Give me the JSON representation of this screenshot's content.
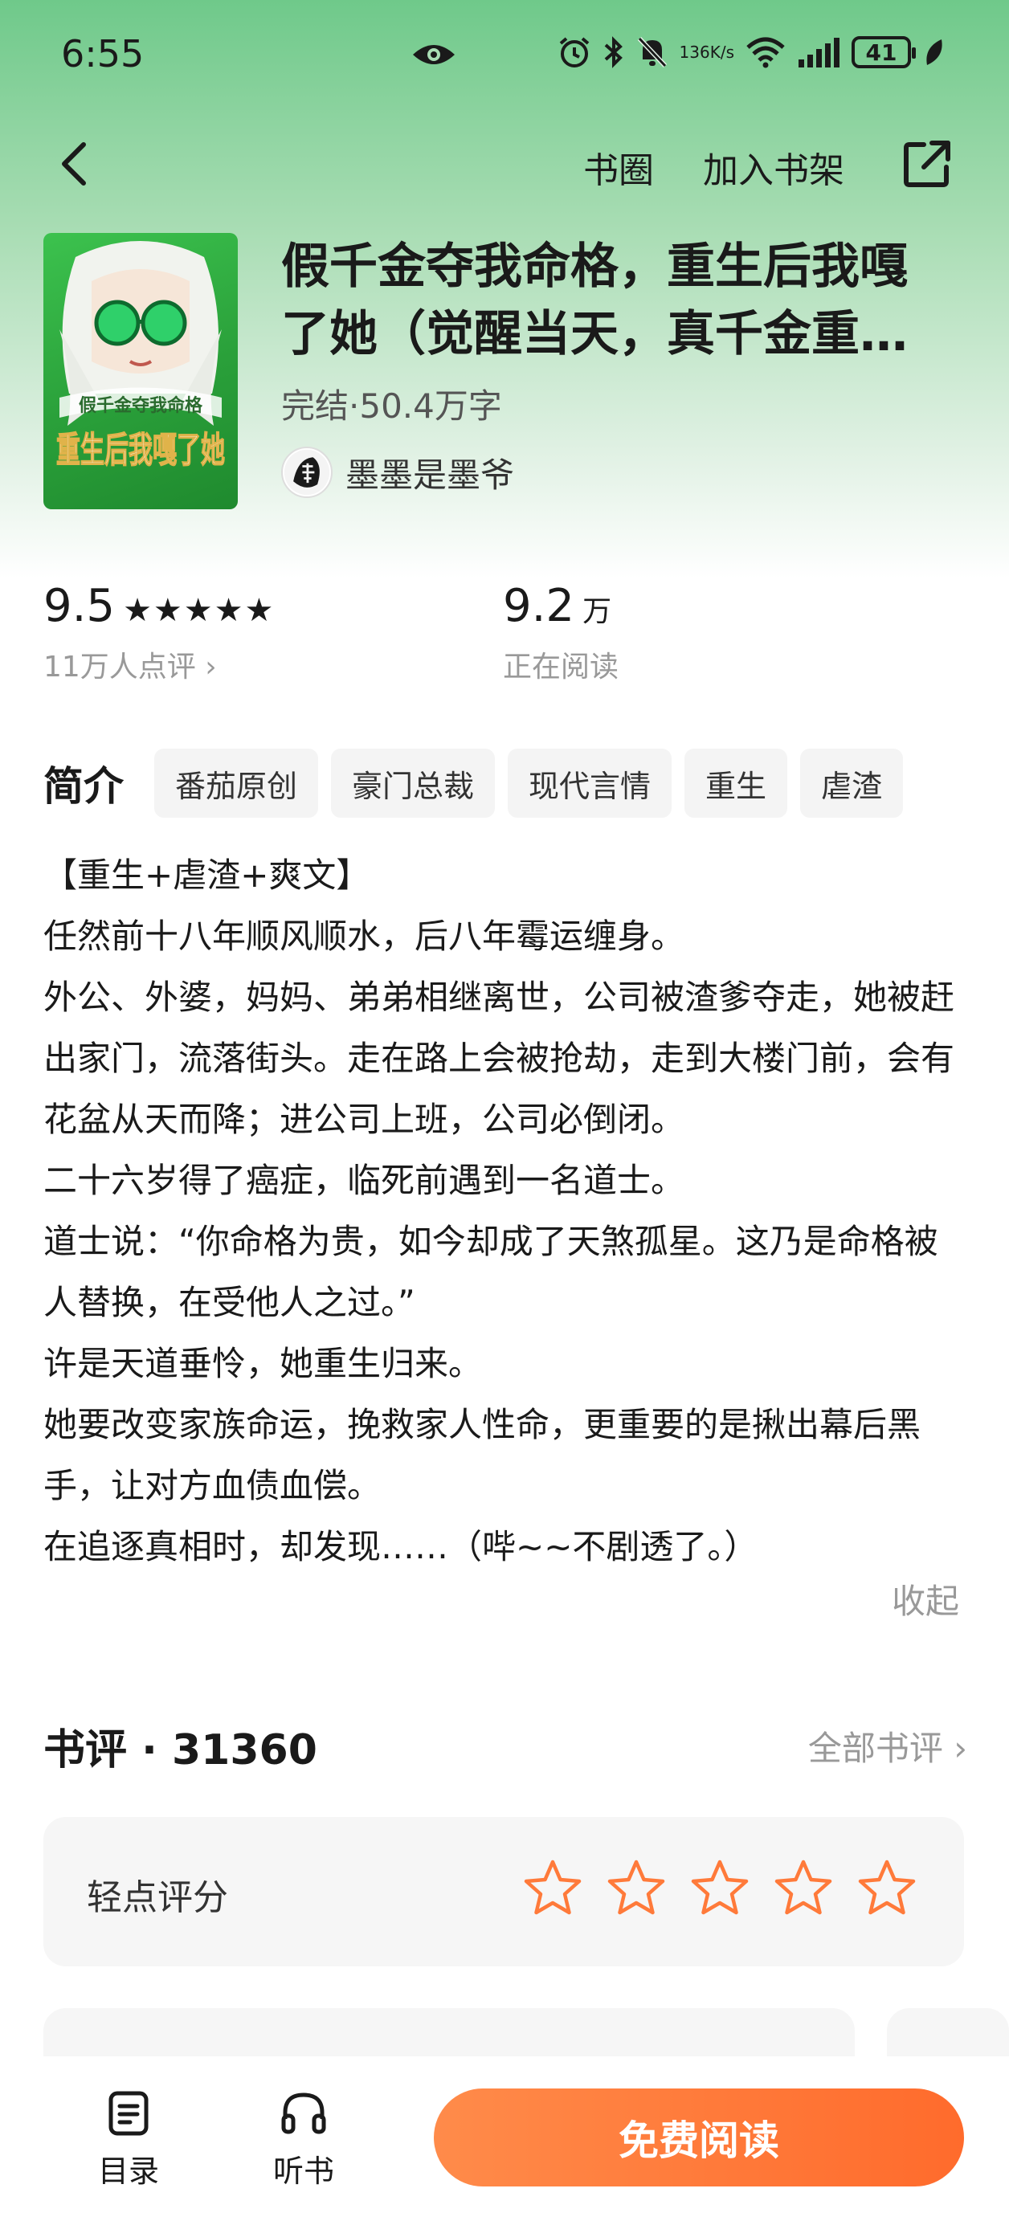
{
  "status_bar": {
    "time": "6:55",
    "net_speed_value": "136",
    "net_speed_unit": "K/s",
    "battery": "41"
  },
  "nav": {
    "book_circle": "书圈",
    "add_shelf": "加入书架"
  },
  "book": {
    "cover_subtitle": "假千金夺我命格",
    "cover_title": "重生后我嘎了她",
    "title": "假千金夺我命格，重生后我嘎了她（觉醒当天，真千金重生归来）",
    "status": "完结·50.4万字",
    "author": "墨墨是墨爷"
  },
  "stats": {
    "rating": "9.5",
    "rating_stars": "★★★★★",
    "rating_sub": "11万人点评",
    "readers": "9.2",
    "readers_unit": "万",
    "readers_sub": "正在阅读"
  },
  "intro": {
    "heading": "简介",
    "tags": [
      "番茄原创",
      "豪门总裁",
      "现代言情",
      "重生",
      "虐渣"
    ]
  },
  "synopsis": {
    "lines": [
      "【重生+虐渣+爽文】",
      "任然前十八年顺风顺水，后八年霉运缠身。",
      "外公、外婆，妈妈、弟弟相继离世，公司被渣爹夺走，她被赶出家门，流落街头。走在路上会被抢劫，走到大楼门前，会有花盆从天而降；进公司上班，公司必倒闭。",
      "二十六岁得了癌症，临死前遇到一名道士。",
      "道士说：“你命格为贵，如今却成了天煞孤星。这乃是命格被人替换，在受他人之过。”",
      "许是天道垂怜，她重生归来。",
      "她要改变家族命运，挽救家人性命，更重要的是揪出幕后黑手，让对方血债血偿。",
      "在追逐真相时，却发现……（哔~~不剧透了。）"
    ],
    "collapse": "收起"
  },
  "reviews": {
    "title": "书评 · 31360",
    "all": "全部书评",
    "rate_label": "轻点评分"
  },
  "bottom": {
    "toc": "目录",
    "listen": "听书",
    "read": "免费阅读"
  },
  "colors": {
    "accent": "#ff6b2c",
    "star_outline": "#ff7a3a",
    "header_green": "#6fc98a"
  }
}
